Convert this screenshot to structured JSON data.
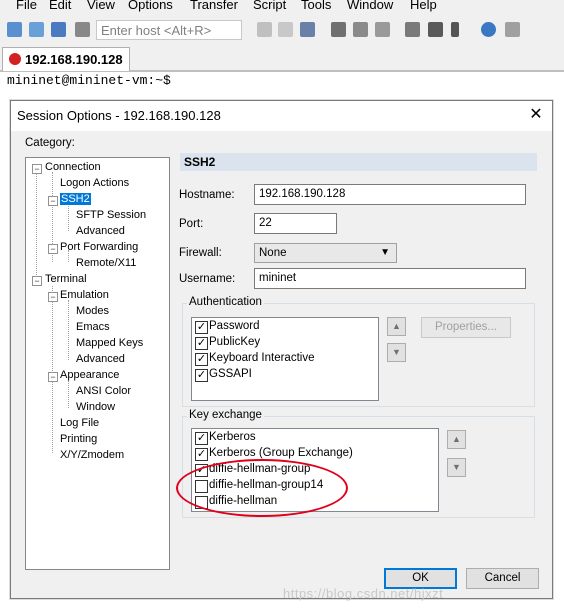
{
  "menu": [
    "File",
    "Edit",
    "View",
    "Options",
    "Transfer",
    "Script",
    "Tools",
    "Window",
    "Help"
  ],
  "toolbar": {
    "host_placeholder": "Enter host <Alt+R>",
    "icons": [
      "connect-icon",
      "quick-connect-icon",
      "reconnect-icon",
      "disconnect-icon",
      "copy-icon",
      "paste-icon",
      "find-icon",
      "print-icon",
      "print-setup-icon",
      "session-options-icon",
      "global-options-icon",
      "keymap-icon",
      "help-icon"
    ]
  },
  "tab": {
    "label": "192.168.190.128"
  },
  "terminal": {
    "prompt": "mininet@mininet-vm:~$"
  },
  "dialog": {
    "title": "Session Options - 192.168.190.128",
    "category_label": "Category:",
    "tree": [
      {
        "label": "Connection"
      },
      {
        "label": "Logon Actions"
      },
      {
        "label": "SSH2",
        "selected": true
      },
      {
        "label": "SFTP Session"
      },
      {
        "label": "Advanced"
      },
      {
        "label": "Port Forwarding"
      },
      {
        "label": "Remote/X11"
      },
      {
        "label": "Terminal"
      },
      {
        "label": "Emulation"
      },
      {
        "label": "Modes"
      },
      {
        "label": "Emacs"
      },
      {
        "label": "Mapped Keys"
      },
      {
        "label": "Advanced"
      },
      {
        "label": "Appearance"
      },
      {
        "label": "ANSI Color"
      },
      {
        "label": "Window"
      },
      {
        "label": "Log File"
      },
      {
        "label": "Printing"
      },
      {
        "label": "X/Y/Zmodem"
      }
    ],
    "section_title": "SSH2",
    "hostname_label": "Hostname:",
    "hostname_value": "192.168.190.128",
    "port_label": "Port:",
    "port_value": "22",
    "firewall_label": "Firewall:",
    "firewall_value": "None",
    "username_label": "Username:",
    "username_value": "mininet",
    "auth": {
      "title": "Authentication",
      "items": [
        {
          "label": "Password",
          "checked": true
        },
        {
          "label": "PublicKey",
          "checked": true
        },
        {
          "label": "Keyboard Interactive",
          "checked": true
        },
        {
          "label": "GSSAPI",
          "checked": true
        }
      ],
      "properties_label": "Properties..."
    },
    "kex": {
      "title": "Key exchange",
      "items": [
        {
          "label": "Kerberos",
          "checked": true
        },
        {
          "label": "Kerberos (Group Exchange)",
          "checked": true
        },
        {
          "label": "diffie-hellman-group",
          "checked": true
        },
        {
          "label": "diffie-hellman-group14",
          "checked": false
        },
        {
          "label": "diffie-hellman",
          "checked": false
        }
      ]
    },
    "ok_label": "OK",
    "cancel_label": "Cancel"
  },
  "watermark": "https://blog.csdn.net/hjxzt"
}
